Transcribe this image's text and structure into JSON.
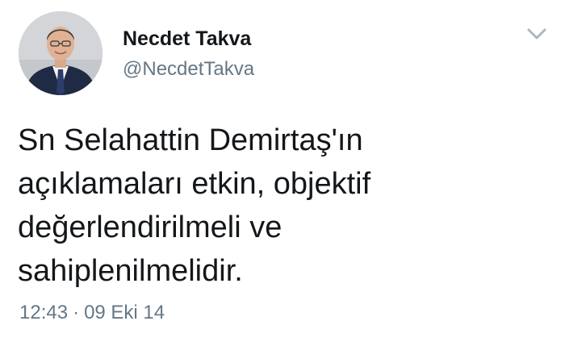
{
  "tweet": {
    "author_name": "Necdet Takva",
    "author_handle": "@NecdetTakva",
    "text": "Sn Selahattin Demirtaş'ın\naçıklamaları etkin, objektif\ndeğerlendirilmeli ve\nsahiplenilmelidir.",
    "time": "12:43",
    "separator": "·",
    "date": "09 Eki 14"
  },
  "icons": {
    "menu": "chevron-down-icon",
    "avatar": "avatar"
  },
  "colors": {
    "text_primary": "#14171a",
    "text_secondary": "#657786",
    "chevron": "#aab8c2",
    "background": "#ffffff"
  }
}
